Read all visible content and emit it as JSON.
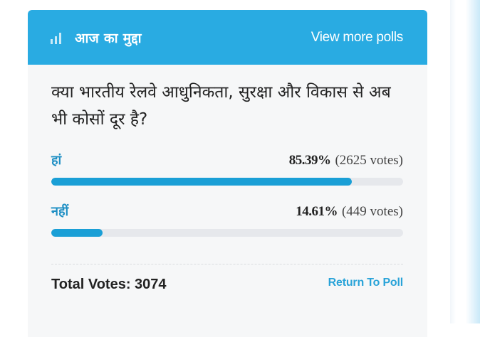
{
  "header": {
    "icon": "bar-chart-icon",
    "title": "आज का मुद्दा",
    "view_more": "View more polls"
  },
  "question": "क्या भारतीय रेलवे आधुनिकता, सुरक्षा और विकास से अब भी कोसों दूर है?",
  "options": [
    {
      "label": "हां",
      "percent_text": "85.39%",
      "votes_text": "(2625 votes)",
      "percent": 85.39
    },
    {
      "label": "नहीं",
      "percent_text": "14.61%",
      "votes_text": "(449 votes)",
      "percent": 14.61
    }
  ],
  "footer": {
    "total_votes": "Total Votes: 3074",
    "return_label": "Return To Poll"
  },
  "colors": {
    "header_bg": "#29abe2",
    "accent": "#1a9fd6",
    "track": "#e6e8ec"
  }
}
